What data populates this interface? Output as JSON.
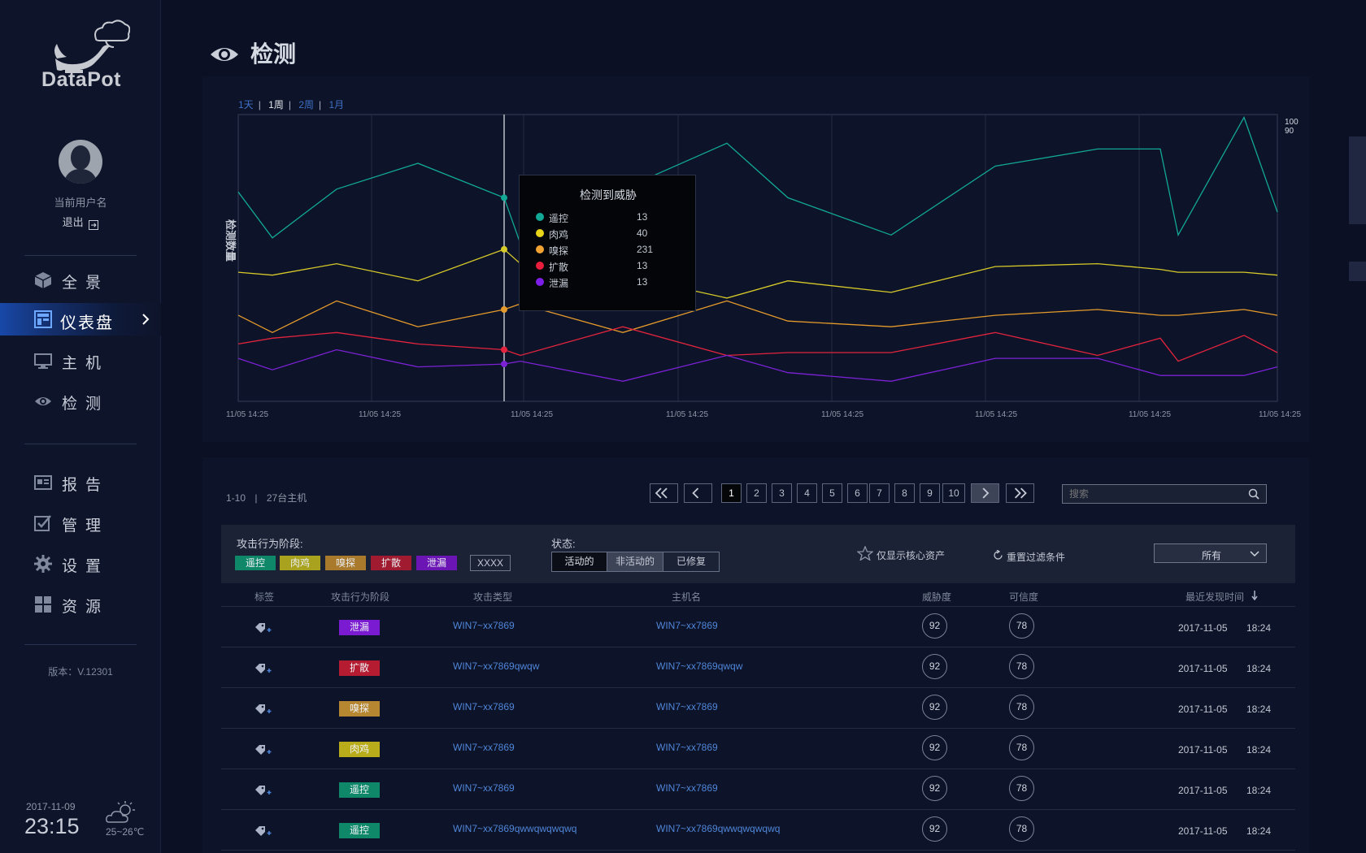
{
  "app": {
    "logo": "DataPot"
  },
  "user": {
    "name": "当前用户名",
    "logout": "退出"
  },
  "nav": {
    "overview": "全景",
    "dashboard": "仪表盘",
    "hosts": "主机",
    "detect": "检测",
    "report": "报告",
    "manage": "管理",
    "settings": "设置",
    "resources": "资源"
  },
  "version": "版本：V.12301",
  "footer": {
    "date": "2017-11-09",
    "time": "23:15",
    "temp": "25~26℃"
  },
  "page_title": "检测",
  "ranges": [
    "1天",
    "1周",
    "2周",
    "1月"
  ],
  "range_selected": "1周",
  "chart_data": {
    "type": "line",
    "ylabel": "检测数量",
    "y_ticks": [
      "100",
      "90"
    ],
    "x_ticks": [
      "11/05 14:25",
      "11/05 14:25",
      "11/05 14:25",
      "11/05 14:25",
      "11/05 14:25",
      "11/05 14:25",
      "11/05 14:25",
      "11/05 14:25"
    ],
    "series": [
      {
        "name": "遥控",
        "color": "#12a895",
        "values": [
          73,
          57,
          74,
          83,
          71,
          55,
          74,
          90,
          71,
          58,
          82,
          88,
          88,
          58,
          99,
          66
        ]
      },
      {
        "name": "肉鸡",
        "color": "#d6c92a",
        "values": [
          45,
          44,
          48,
          42,
          53,
          48,
          44,
          36,
          42,
          38,
          47,
          48,
          46,
          45,
          45,
          44
        ]
      },
      {
        "name": "嗅探",
        "color": "#e49a2c",
        "values": [
          30,
          24,
          35,
          26,
          32,
          34,
          24,
          35,
          28,
          26,
          30,
          32,
          30,
          30,
          32,
          30
        ]
      },
      {
        "name": "扩散",
        "color": "#e2243e",
        "values": [
          20,
          22,
          24,
          20,
          18,
          16,
          26,
          16,
          17,
          17,
          24,
          16,
          22,
          14,
          23,
          17
        ]
      },
      {
        "name": "泄漏",
        "color": "#7b22d6",
        "values": [
          15,
          11,
          18,
          12,
          13,
          14,
          7,
          16,
          10,
          7,
          15,
          15,
          9,
          9,
          9,
          12
        ]
      }
    ],
    "tooltip": {
      "title": "检测到威胁",
      "rows": [
        {
          "name": "遥控",
          "value": "13",
          "color": "#12a895"
        },
        {
          "name": "肉鸡",
          "value": "40",
          "color": "#e8d419"
        },
        {
          "name": "嗅探",
          "value": "231",
          "color": "#f0a233"
        },
        {
          "name": "扩散",
          "value": "13",
          "color": "#e81e3c"
        },
        {
          "name": "泄漏",
          "value": "13",
          "color": "#7d1ee8"
        }
      ]
    }
  },
  "table": {
    "count": "1-10",
    "total": "27台主机",
    "pager": [
      "1",
      "2",
      "3",
      "4",
      "5",
      "6",
      "7",
      "8",
      "9",
      "10"
    ],
    "search_placeholder": "搜索",
    "filter_stage_label": "攻击行为阶段:",
    "stage_tags": [
      {
        "label": "遥控",
        "color": "#0f8769"
      },
      {
        "label": "肉鸡",
        "color": "#a9a21e"
      },
      {
        "label": "嗅探",
        "color": "#a9792c"
      },
      {
        "label": "扩散",
        "color": "#a11b30"
      },
      {
        "label": "泄漏",
        "color": "#6b16b4"
      }
    ],
    "other_tag": "XXXX",
    "state_label": "状态:",
    "states": [
      "活动的",
      "非活动的",
      "已修复"
    ],
    "core_only": "仅显示核心资产",
    "reset": "重置过滤条件",
    "dropdown": "所有",
    "headers": {
      "tag": "标签",
      "stage": "攻击行为阶段",
      "type": "攻击类型",
      "host": "主机名",
      "threat": "威胁度",
      "cred": "可信度",
      "time": "最近发现时间"
    },
    "rows": [
      {
        "stage": "泄漏",
        "stage_color": "#7a1bd1",
        "type": "WIN7~xx7869",
        "host": "WIN7~xx7869",
        "threat": "92",
        "cred": "78",
        "date": "2017-11-05",
        "time": "18:24"
      },
      {
        "stage": "扩散",
        "stage_color": "#b51b31",
        "type": "WIN7~xx7869qwqw",
        "host": "WIN7~xx7869qwqw",
        "threat": "92",
        "cred": "78",
        "date": "2017-11-05",
        "time": "18:24"
      },
      {
        "stage": "嗅探",
        "stage_color": "#b68630",
        "type": "WIN7~xx7869",
        "host": "WIN7~xx7869",
        "threat": "92",
        "cred": "78",
        "date": "2017-11-05",
        "time": "18:24"
      },
      {
        "stage": "肉鸡",
        "stage_color": "#b8ac1b",
        "type": "WIN7~xx7869",
        "host": "WIN7~xx7869",
        "threat": "92",
        "cred": "78",
        "date": "2017-11-05",
        "time": "18:24"
      },
      {
        "stage": "遥控",
        "stage_color": "#0f8769",
        "type": "WIN7~xx7869",
        "host": "WIN7~xx7869",
        "threat": "92",
        "cred": "78",
        "date": "2017-11-05",
        "time": "18:24"
      },
      {
        "stage": "遥控",
        "stage_color": "#0f8769",
        "type": "WIN7~xx7869qwwqwqwqwq",
        "host": "WIN7~xx7869qwwqwqwqwq",
        "threat": "92",
        "cred": "78",
        "date": "2017-11-05",
        "time": "18:24"
      }
    ]
  }
}
